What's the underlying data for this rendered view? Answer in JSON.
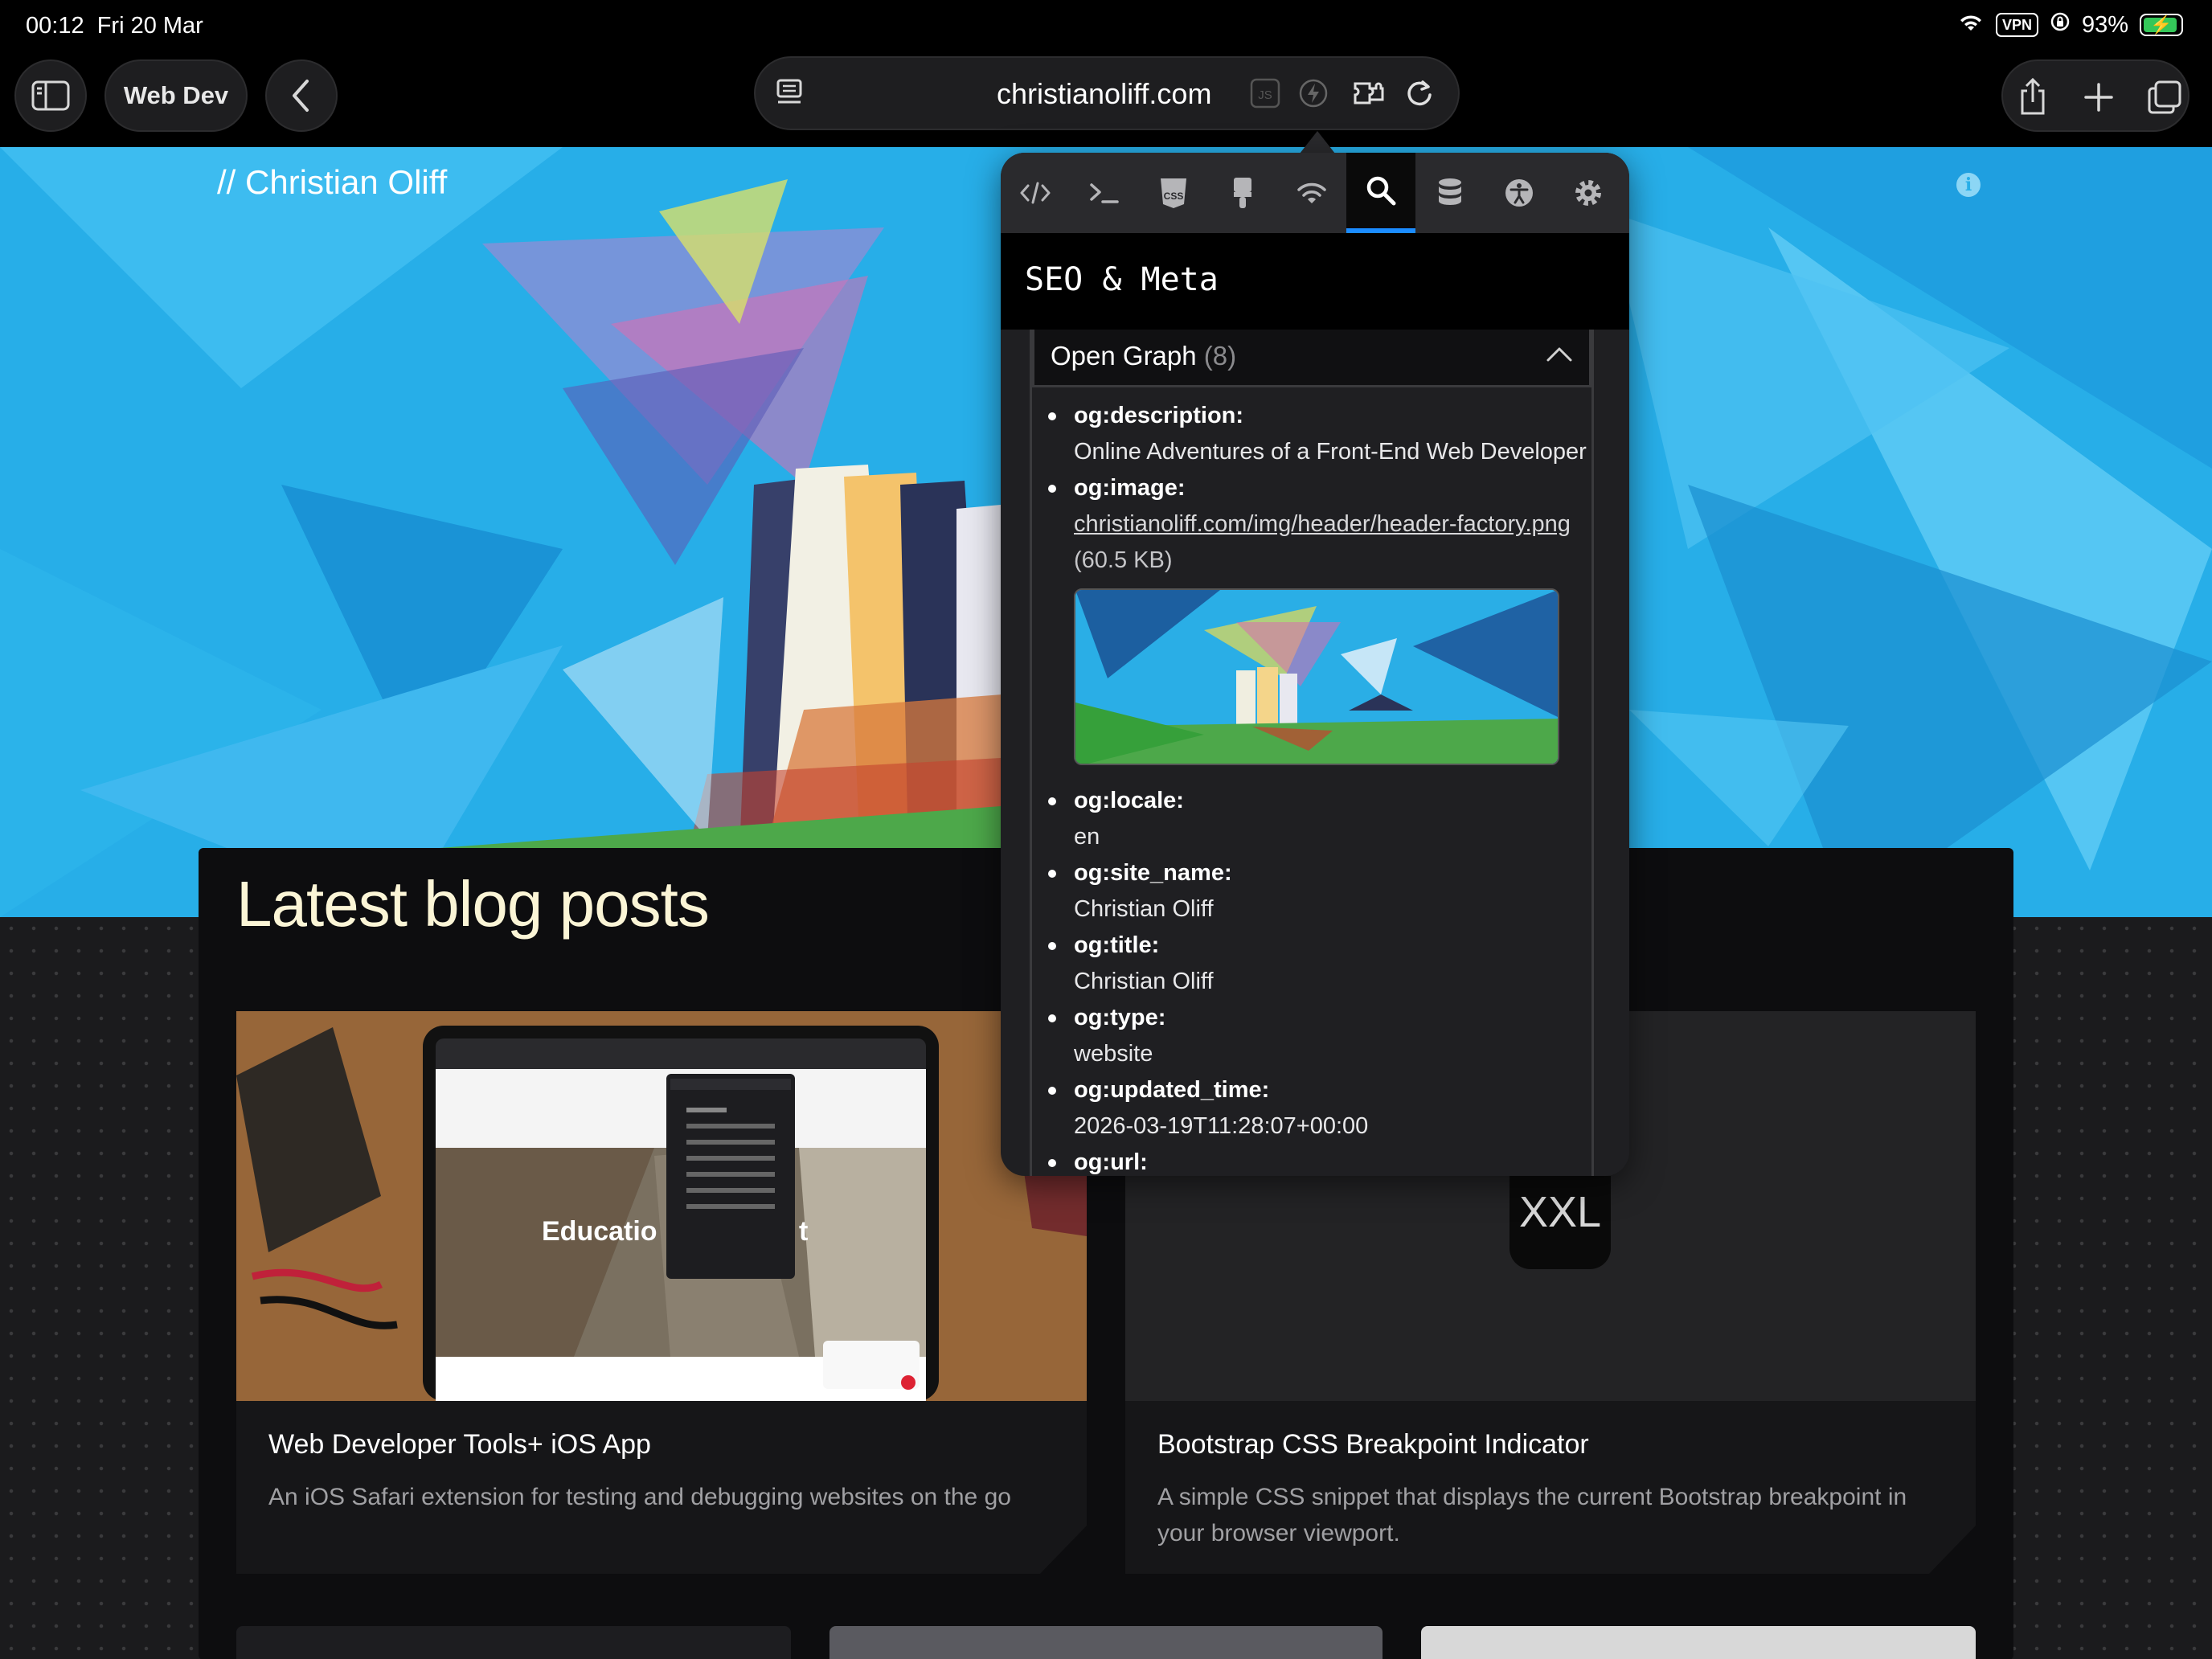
{
  "status_bar": {
    "time": "00:12",
    "date": "Fri 20 Mar",
    "vpn": "VPN",
    "battery": "93%",
    "battery_level": 0.93
  },
  "toolbar": {
    "tab_group": "Web Dev",
    "url": "christianoliff.com"
  },
  "site": {
    "brand": "// Christian Oliff",
    "section_title": "Latest blog posts"
  },
  "cards": [
    {
      "title": "Web Developer Tools+ iOS App",
      "description": "An iOS Safari extension for testing and debugging websites on the go",
      "image_text": "Educatio",
      "image_text2": "t"
    },
    {
      "title": "Bootstrap CSS Breakpoint Indicator",
      "description": "A simple CSS snippet that displays the current Bootstrap breakpoint in your browser viewport.",
      "badge": "XXL"
    }
  ],
  "panel": {
    "tabs": [
      "html-tab",
      "console-tab",
      "css-tab",
      "design-tab",
      "network-tab",
      "seo-tab",
      "storage-tab",
      "accessibility-tab",
      "settings-tab"
    ],
    "active_tab": "seo-tab",
    "title": "SEO & Meta",
    "section": {
      "label": "Open Graph",
      "count": "(8)"
    },
    "og": [
      {
        "key": "og:description:",
        "value": "Online Adventures of a Front-End Web Developer"
      },
      {
        "key": "og:image:",
        "value": "christianoliff.com/img/header/header-factory.png",
        "size": "(60.5 KB)"
      },
      {
        "key": "og:locale:",
        "value": "en"
      },
      {
        "key": "og:site_name:",
        "value": "Christian Oliff"
      },
      {
        "key": "og:title:",
        "value": "Christian Oliff"
      },
      {
        "key": "og:type:",
        "value": "website"
      },
      {
        "key": "og:updated_time:",
        "value": "2026-03-19T11:28:07+00:00"
      },
      {
        "key": "og:url:",
        "value": ""
      }
    ]
  },
  "colors": {
    "hero_sky": "#27aee8",
    "title_cream": "#fbf5d6",
    "tab_active_accent": "#1b8cff",
    "battery_green": "#34c759"
  }
}
